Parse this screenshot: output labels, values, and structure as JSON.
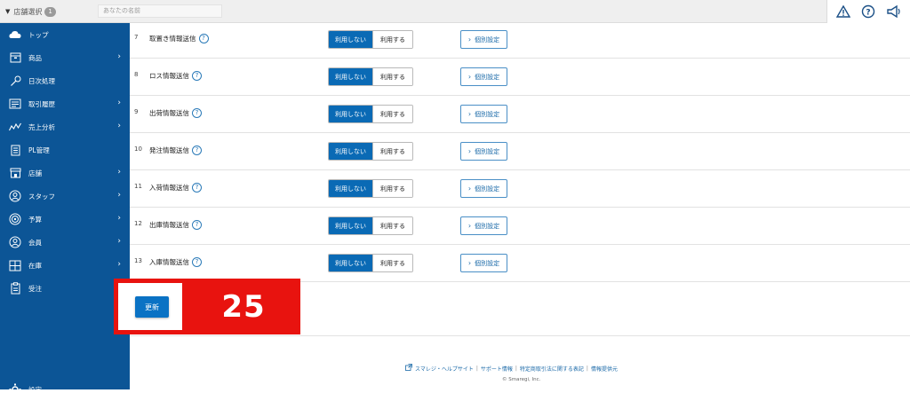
{
  "topbar": {
    "store_select_label": "店舗選択",
    "store_count": "1",
    "store_placeholder": "あなたの名前"
  },
  "sidebar": {
    "items": [
      {
        "label": "トップ",
        "icon": "cloud-icon",
        "has_arrow": false
      },
      {
        "label": "商品",
        "icon": "box-icon",
        "has_arrow": true
      },
      {
        "label": "日次処理",
        "icon": "key-icon",
        "has_arrow": false
      },
      {
        "label": "取引履歴",
        "icon": "register-icon",
        "has_arrow": true
      },
      {
        "label": "売上分析",
        "icon": "chart-icon",
        "has_arrow": true
      },
      {
        "label": "PL管理",
        "icon": "document-icon",
        "has_arrow": false
      },
      {
        "label": "店舗",
        "icon": "store-icon",
        "has_arrow": true
      },
      {
        "label": "スタッフ",
        "icon": "person-icon",
        "has_arrow": true
      },
      {
        "label": "予算",
        "icon": "target-icon",
        "has_arrow": true
      },
      {
        "label": "会員",
        "icon": "member-icon",
        "has_arrow": true
      },
      {
        "label": "在庫",
        "icon": "grid-icon",
        "has_arrow": true
      },
      {
        "label": "受注",
        "icon": "clipboard-icon",
        "has_arrow": false
      },
      {
        "label": "設定",
        "icon": "gear-icon",
        "has_arrow": false
      }
    ]
  },
  "rows": [
    {
      "num": "7",
      "title": "取置き情報送信"
    },
    {
      "num": "8",
      "title": "ロス情報送信"
    },
    {
      "num": "9",
      "title": "出荷情報送信"
    },
    {
      "num": "10",
      "title": "発注情報送信"
    },
    {
      "num": "11",
      "title": "入荷情報送信"
    },
    {
      "num": "12",
      "title": "出庫情報送信"
    },
    {
      "num": "13",
      "title": "入庫情報送信"
    }
  ],
  "toggle": {
    "off_label": "利用しない",
    "on_label": "利用する"
  },
  "detail_label": "個別設定",
  "help_glyph": "?",
  "update_label": "更新",
  "annotation_number": "25",
  "footer": {
    "links": [
      "スマレジ・ヘルプサイト",
      "サポート情報",
      "特定商取引法に関する表記",
      "情報提供元"
    ],
    "separator": "|",
    "copyright": "© Smaregi, Inc."
  },
  "colors": {
    "sidebar": "#0c5596",
    "primary": "#0a6ab5",
    "annotation_red": "#e8130f"
  }
}
